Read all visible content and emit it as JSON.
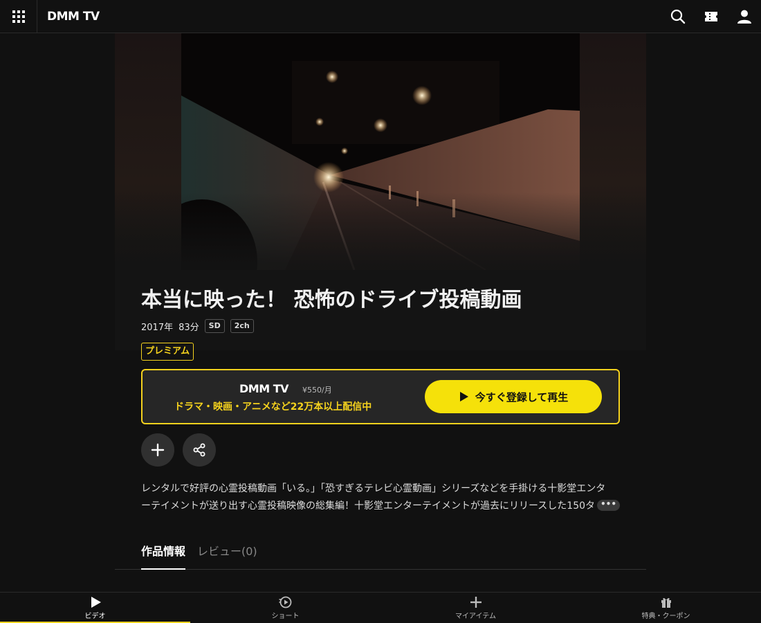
{
  "header": {
    "logo": "DMM TV"
  },
  "video": {
    "title": "本当に映った！ 恐怖のドライブ投稿動画",
    "year": "2017年",
    "duration": "83分",
    "quality_badge": "SD",
    "audio_badge": "2ch",
    "premium_label": "プレミアム"
  },
  "subscribe": {
    "logo": "DMM TV",
    "price": "¥550/月",
    "tagline": "ドラマ・映画・アニメなど22万本以上配信中",
    "cta_label": "今すぐ登録して再生"
  },
  "description": {
    "line1": "レンタルで好評の心霊投稿動画「いる。」「恐すぎるテレビ心霊動画」シリーズなどを手掛ける十影堂エンタ",
    "line2": "ーテイメントが送り出す心霊投稿映像の総集編！十影堂エンターテイメントが過去にリリースした150タ",
    "more_label": "•••"
  },
  "tabs": [
    {
      "label": "作品情報",
      "active": true
    },
    {
      "label": "レビュー(0)",
      "active": false
    }
  ],
  "bottom_nav": [
    {
      "label": "ビデオ",
      "icon": "play-icon",
      "active": true
    },
    {
      "label": "ショート",
      "icon": "short-icon",
      "active": false
    },
    {
      "label": "マイアイテム",
      "icon": "plus-icon",
      "active": false
    },
    {
      "label": "特典・クーポン",
      "icon": "gift-icon",
      "active": false
    }
  ],
  "colors": {
    "accent": "#f5d21d",
    "cta": "#f5e10a",
    "background": "#111111"
  }
}
